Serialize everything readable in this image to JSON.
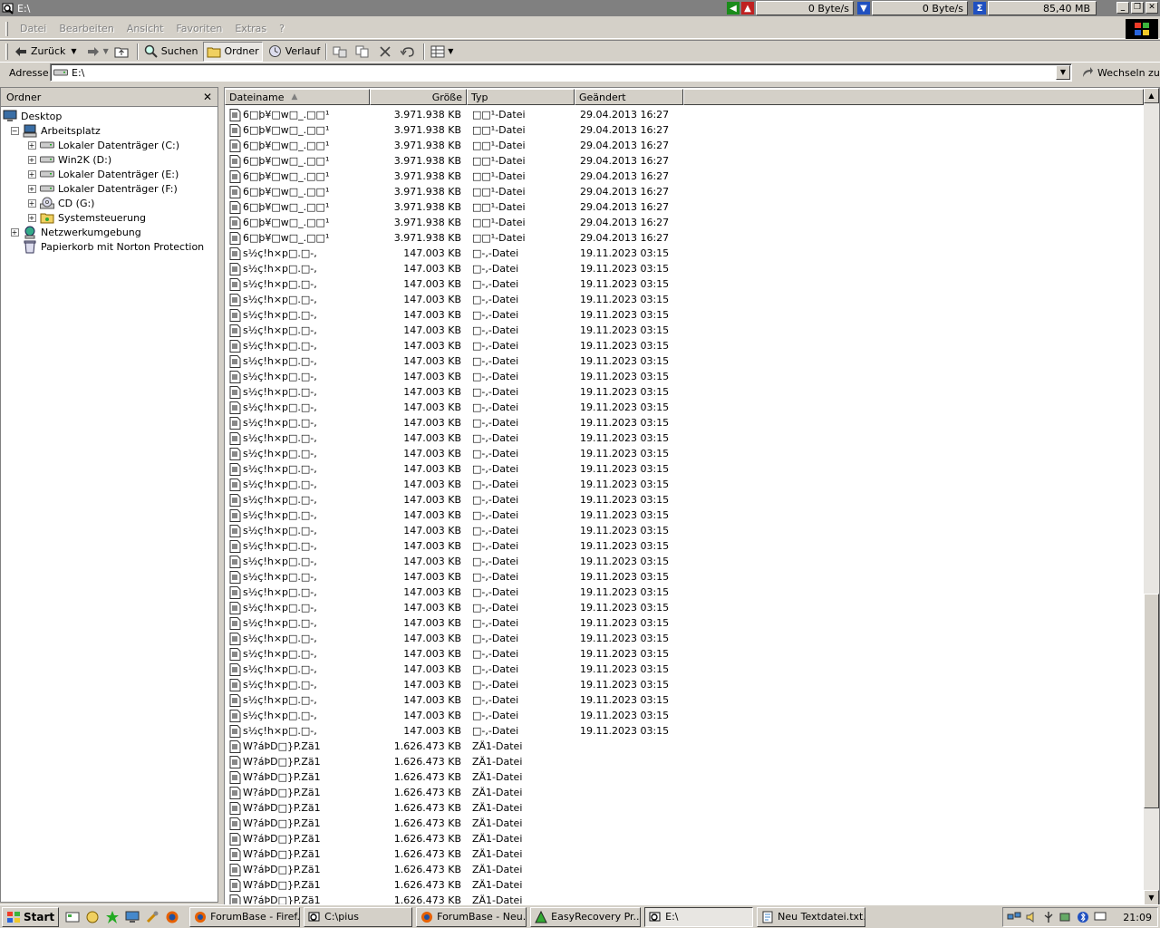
{
  "window": {
    "title": "E:\\",
    "meter_left": "0 Byte/s",
    "meter_right": "0 Byte/s",
    "meter_mem": "85,40 MB"
  },
  "menu": [
    "Datei",
    "Bearbeiten",
    "Ansicht",
    "Favoriten",
    "Extras",
    "?"
  ],
  "toolbar": {
    "back": "Zurück",
    "search": "Suchen",
    "folders": "Ordner",
    "history": "Verlauf"
  },
  "address": {
    "label": "Adresse",
    "value": "E:\\",
    "go": "Wechseln zu"
  },
  "folder_pane": {
    "title": "Ordner",
    "tree": [
      {
        "label": "Desktop",
        "indent": 0,
        "icon": "desktop-icon",
        "exp": ""
      },
      {
        "label": "Arbeitsplatz",
        "indent": 1,
        "icon": "computer-icon",
        "exp": "−"
      },
      {
        "label": "Lokaler Datenträger (C:)",
        "indent": 2,
        "icon": "drive-icon",
        "exp": "+"
      },
      {
        "label": "Win2K (D:)",
        "indent": 2,
        "icon": "drive-icon",
        "exp": "+"
      },
      {
        "label": "Lokaler Datenträger (E:)",
        "indent": 2,
        "icon": "drive-icon",
        "exp": "+"
      },
      {
        "label": "Lokaler Datenträger (F:)",
        "indent": 2,
        "icon": "drive-icon",
        "exp": "+"
      },
      {
        "label": "CD (G:)",
        "indent": 2,
        "icon": "cd-icon",
        "exp": "+"
      },
      {
        "label": "Systemsteuerung",
        "indent": 2,
        "icon": "control-panel-icon",
        "exp": "+"
      },
      {
        "label": "Netzwerkumgebung",
        "indent": 1,
        "icon": "network-icon",
        "exp": "+"
      },
      {
        "label": "Papierkorb mit Norton Protection",
        "indent": 1,
        "icon": "recycle-bin-icon",
        "exp": ""
      }
    ]
  },
  "file_list": {
    "columns": [
      "Dateiname",
      "Größe",
      "Typ",
      "Geändert"
    ],
    "groups": [
      {
        "count": 9,
        "name": "6□þ¥□w□_.□□¹",
        "size": "3.971.938 KB",
        "type": "□□¹-Datei",
        "date": "29.04.2013 16:27"
      },
      {
        "count": 32,
        "name": "s½ç!h×p□.□-,",
        "size": "147.003 KB",
        "type": "□-,-Datei",
        "date": "19.11.2023 03:15"
      },
      {
        "count": 11,
        "name": "W?áÞD□}P.Zä1",
        "size": "1.626.473 KB",
        "type": "ZÄ1-Datei",
        "date": ""
      }
    ]
  },
  "taskbar": {
    "start": "Start",
    "tasks": [
      "ForumBase - Firef...",
      "C:\\pius",
      "ForumBase - Neu...",
      "EasyRecovery Pr...",
      "E:\\",
      "Neu Textdatei.txt..."
    ],
    "active_task": 4,
    "clock": "21:09"
  }
}
